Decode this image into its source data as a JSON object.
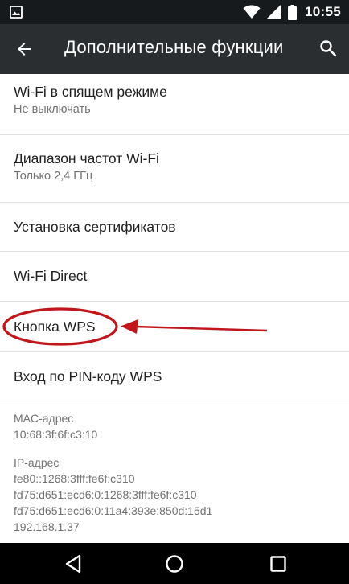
{
  "status_bar": {
    "time": "10:55",
    "icons": [
      "image-notification-icon",
      "wifi-icon",
      "signal-icon",
      "battery-icon"
    ]
  },
  "toolbar": {
    "title": "Дополнительные функции",
    "back_icon": "arrow-left-icon",
    "search_icon": "search-icon"
  },
  "settings": {
    "wifi_sleep": {
      "title": "Wi-Fi в спящем режиме",
      "summary": "Не выключать"
    },
    "frequency_band": {
      "title": "Диапазон частот Wi-Fi",
      "summary": "Только 2,4 ГГц"
    },
    "install_certificates": {
      "title": "Установка сертификатов"
    },
    "wifi_direct": {
      "title": "Wi-Fi Direct"
    },
    "wps_button": {
      "title": "Кнопка WPS"
    },
    "wps_pin": {
      "title": "Вход по PIN-коду WPS"
    }
  },
  "info": {
    "mac": {
      "label": "MAC-адрес",
      "value": "10:68:3f:6f:c3:10"
    },
    "ip": {
      "label": "IP-адрес",
      "values": [
        "fe80::1268:3fff:fe6f:c310",
        "fd75:d651:ecd6:0:1268:3fff:fe6f:c310",
        "fd75:d651:ecd6:0:11a4:393e:850d:15d1",
        "192.168.1.37"
      ]
    }
  },
  "nav_bar": {
    "buttons": [
      "back-triangle-icon",
      "home-circle-icon",
      "recents-square-icon"
    ]
  },
  "colors": {
    "status_bar": "#171a1c",
    "toolbar": "#2b2e31",
    "annotation": "#c0161c",
    "primary_text": "#212121",
    "secondary_text": "#727272"
  }
}
